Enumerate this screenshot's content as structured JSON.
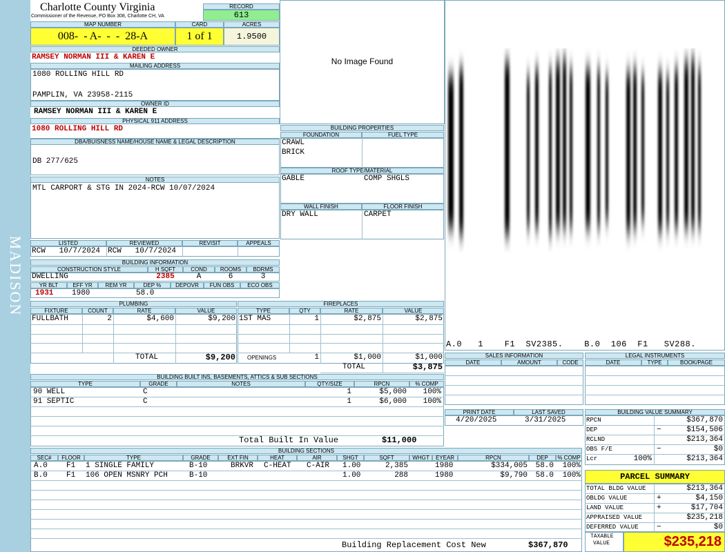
{
  "sidebar": {
    "district": "MADISON"
  },
  "header": {
    "county": "Charlotte County Virginia",
    "commissioner": "Commissioner of the Revenue, PO Box 308, Charlotte CH, VA",
    "record_label": "RECORD",
    "record": "613",
    "map_label": "MAP NUMBER",
    "map_number": "008-  - A-  -  -  28-A",
    "card_label": "CARD",
    "card": "1 of 1",
    "acres_label": "ACRES",
    "acres": "1.9500"
  },
  "owner": {
    "deeded_label": "DEEDED OWNER",
    "deeded_owner": "RAMSEY NORMAN III & KAREN E",
    "mailing_label": "MAILING ADDRESS",
    "addr1": "1080 ROLLING HILL RD",
    "addr2": "PAMPLIN, VA 23958-2115",
    "owner_id_label": "OWNER ID",
    "owner_id": "RAMSEY NORMAN III & KAREN E",
    "phys_label": "PHYSICAL 911 ADDRESS",
    "phys_addr": "1080 ROLLING HILL RD"
  },
  "dba": {
    "label": "DBA/BUISNESS NAME/HOUSE NAME & LEGAL DESCRIPTION",
    "text": "DB 277/625"
  },
  "notes": {
    "label": "NOTES",
    "text": "MTL CARPORT & STG IN 2024-RCW 10/07/2024"
  },
  "review": {
    "h_listed": "LISTED",
    "h_reviewed": "REVIEWED",
    "h_revisit": "REVISIT",
    "h_appeals": "APPEALS",
    "listed": "RCW   10/7/2024",
    "reviewed": "RCW   10/7/2024"
  },
  "building_info": {
    "title": "BUILDING INFORMATION",
    "h_style": "CONSTRUCTION STYLE",
    "h_hsqft": "H SQFT",
    "h_cond": "COND",
    "h_rooms": "ROOMS",
    "h_bdrms": "BDRMS",
    "style": "DWELLING",
    "hsqft": "2385",
    "cond": "A",
    "rooms": "6",
    "bdrms": "3",
    "h_yrblt": "YR BLT",
    "h_effyr": "EFF YR",
    "h_remyr": "REM YR",
    "h_dep": "DEP %",
    "h_depovr": "DEPOVR",
    "h_funobs": "FUN OBS",
    "h_ecoobs": "ECO OBS",
    "yrblt": "1931",
    "effyr": "1980",
    "dep": "58.0"
  },
  "image": {
    "text": "No Image Found"
  },
  "sketch": {
    "caption": "A.0   1    F1  SV2385.    B.0  106  F1   SV288."
  },
  "props": {
    "title": "BUILDING PROPERTIES",
    "h_found": "FOUNDATION",
    "h_fuel": "FUEL TYPE",
    "found1": "CRAWL",
    "found2": "BRICK",
    "h_roof": "ROOF TYPE/MATERIAL",
    "roof": "GABLE",
    "roofmat": "COMP SHGLS",
    "h_wall": "WALL FINISH",
    "h_floor": "FLOOR FINISH",
    "wall": "DRY WALL",
    "floor": "CARPET"
  },
  "plumbing": {
    "title": "PLUMBING",
    "h_fixture": "FIXTURE",
    "h_count": "COUNT",
    "h_rate": "RATE",
    "h_value": "VALUE",
    "fixture": "FULLBATH",
    "count": "2",
    "rate": "$4,600",
    "value": "$9,200",
    "total_label": "TOTAL",
    "total": "$9,200"
  },
  "fireplaces": {
    "title": "FIREPLACES",
    "h_type": "TYPE",
    "h_qty": "QTY",
    "h_rate": "RATE",
    "h_value": "VALUE",
    "type": "1ST MAS",
    "qty": "1",
    "rate": "$2,875",
    "value": "$2,875",
    "open_label": "OPENINGS",
    "open_qty": "1",
    "open_rate": "$1,000",
    "open_value": "$1,000",
    "total_label": "TOTAL",
    "total": "$3,875"
  },
  "builtins": {
    "title": "BUILDING BUILT INS, BASEMENTS, ATTICS & SUB SECTIONS",
    "h_type": "TYPE",
    "h_grade": "GRADE",
    "h_notes": "NOTES",
    "h_qty": "QTY/SIZE",
    "h_rpcn": "RPCN",
    "h_comp": "% COMP",
    "rows": [
      {
        "type": "90 WELL",
        "grade": "C",
        "qty": "1",
        "rpcn": "$5,000",
        "comp": "100%"
      },
      {
        "type": "91 SEPTIC",
        "grade": "C",
        "qty": "1",
        "rpcn": "$6,000",
        "comp": "100%"
      }
    ],
    "total_label": "Total Built In Value",
    "total": "$11,000"
  },
  "sections": {
    "title": "BUILDING SECTIONS",
    "h": [
      "SEC#",
      "FLOOR",
      "TYPE",
      "GRADE",
      "EXT FIN",
      "HEAT",
      "AIR",
      "SHGT",
      "SQFT",
      "WHGT",
      "EYEAR",
      "RPCN",
      "DEP",
      "% COMP"
    ],
    "rows": [
      [
        "A.0",
        "F1",
        "1 SINGLE FAMILY",
        "B-10",
        "BRKVR",
        "C-HEAT",
        "C-AIR",
        "1.00",
        "2,385",
        "",
        "1980",
        "$334,005",
        "58.0",
        "100%"
      ],
      [
        "B.0",
        "F1",
        "106 OPEN MSNRY PCH",
        "B-10",
        "",
        "",
        "",
        "1.00",
        "288",
        "",
        "1980",
        "$9,790",
        "58.0",
        "100%"
      ]
    ],
    "total_label": "Building Replacement Cost New",
    "total": "$367,870"
  },
  "sales": {
    "title": "SALES INFORMATION",
    "h_date": "DATE",
    "h_amount": "AMOUNT",
    "h_code": "CODE"
  },
  "legal": {
    "title": "LEGAL INSTRUMENTS",
    "h_date": "DATE",
    "h_type": "TYPE",
    "h_book": "BOOK/PAGE"
  },
  "dates": {
    "h_print": "PRINT DATE",
    "h_saved": "LAST SAVED",
    "print": "4/20/2025",
    "saved": "3/31/2025"
  },
  "bvs": {
    "title": "BUILDING VALUE SUMMARY",
    "rpcn_l": "RPCN",
    "rpcn": "$367,870",
    "dep_l": "DEP",
    "dep_s": "−",
    "dep": "$154,506",
    "rclnd_l": "RCLND",
    "rclnd": "$213,364",
    "obs_l": "OBS F/E",
    "obs_s": "−",
    "obs": "$0",
    "lcr_l": "Lcr",
    "lcr_pct": "100%",
    "lcr": "$213,364"
  },
  "parcel": {
    "title": "PARCEL SUMMARY",
    "bldg_l": "TOTAL BLDG VALUE",
    "bldg": "$213,364",
    "obldg_l": "OBLDG VALUE",
    "obldg_s": "+",
    "obldg": "$4,150",
    "land_l": "LAND VALUE",
    "land_s": "+",
    "land": "$17,704",
    "appr_l": "APPRAISED VALUE",
    "appr": "$235,218",
    "def_l": "DEFERRED VALUE",
    "def_s": "−",
    "def": "$0",
    "tax_l1": "TAXABLE",
    "tax_l2": "VALUE",
    "tax": "$235,218"
  },
  "colors": {
    "sidebar": "#a9d0e0",
    "header": "#cde8f2",
    "yellow": "#ffff33",
    "green": "#90ee90",
    "red": "#c00000"
  }
}
